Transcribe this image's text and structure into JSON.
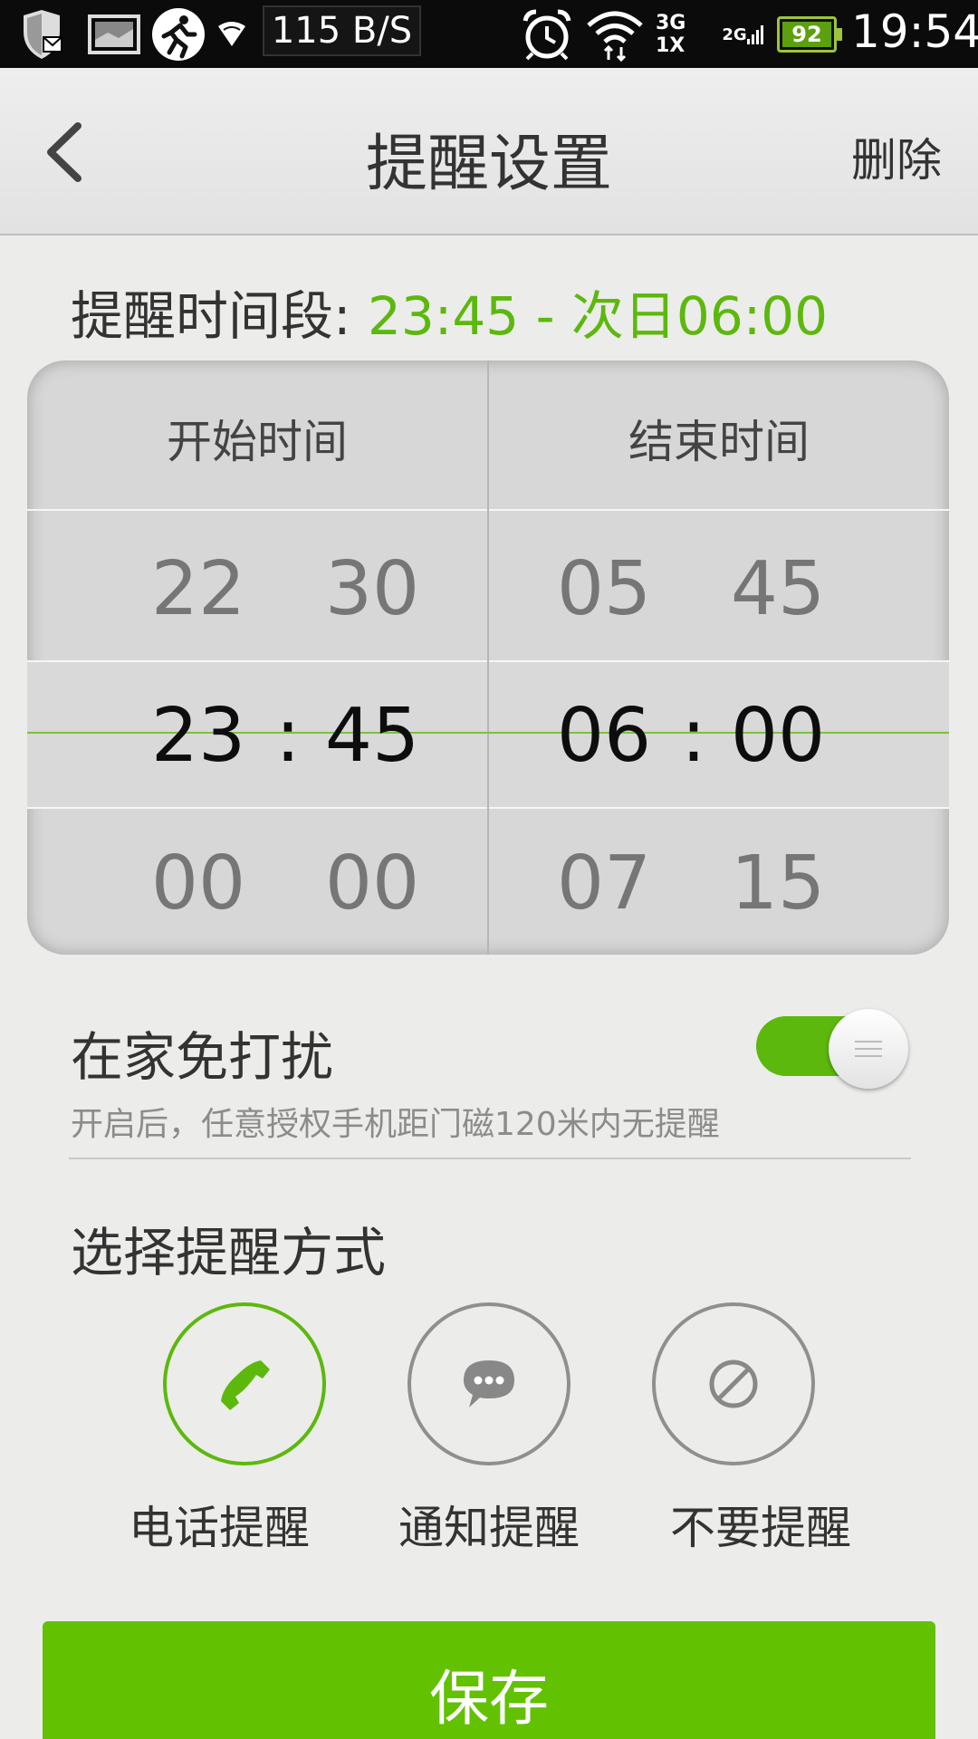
{
  "status_bar": {
    "net_speed": "115 B/S",
    "sig_3g": "3G",
    "sig_1x": "1X",
    "sig_2g": "2G",
    "battery": "92",
    "time": "19:54"
  },
  "header": {
    "title": "提醒设置",
    "delete_label": "删除"
  },
  "range": {
    "label": "提醒时间段: ",
    "value": "23:45 - 次日06:00"
  },
  "picker": {
    "start_header": "开始时间",
    "end_header": "结束时间",
    "start_hours": [
      "22",
      "23",
      "00"
    ],
    "start_minutes": [
      "30",
      "45",
      "00"
    ],
    "end_hours": [
      "05",
      "06",
      "07"
    ],
    "end_minutes": [
      "45",
      "00",
      "15"
    ],
    "colon": ":"
  },
  "home_mode": {
    "title": "在家免打扰",
    "description": "开启后，任意授权手机距门磁120米内无提醒",
    "enabled": true
  },
  "alert_mode": {
    "title": "选择提醒方式",
    "options": [
      {
        "label": "电话提醒",
        "icon": "phone-icon",
        "selected": true
      },
      {
        "label": "通知提醒",
        "icon": "chat-bubble-icon",
        "selected": false
      },
      {
        "label": "不要提醒",
        "icon": "no-entry-icon",
        "selected": false
      }
    ]
  },
  "save_label": "保存",
  "colors": {
    "accent": "#5cb80d",
    "save_button": "#62c100"
  }
}
